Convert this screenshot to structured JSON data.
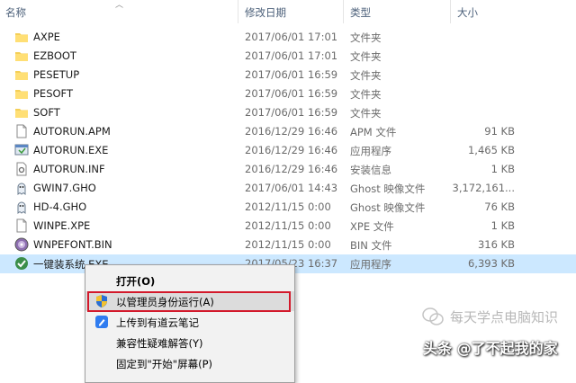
{
  "columns": {
    "name": "名称",
    "modified": "修改日期",
    "type": "类型",
    "size": "大小"
  },
  "files": [
    {
      "name": "AXPE",
      "modified": "2017/06/01 17:01",
      "type": "文件夹",
      "size": "",
      "icon": "folder-icon"
    },
    {
      "name": "EZBOOT",
      "modified": "2017/06/01 17:01",
      "type": "文件夹",
      "size": "",
      "icon": "folder-icon"
    },
    {
      "name": "PESETUP",
      "modified": "2017/06/01 16:59",
      "type": "文件夹",
      "size": "",
      "icon": "folder-icon"
    },
    {
      "name": "PESOFT",
      "modified": "2017/06/01 16:59",
      "type": "文件夹",
      "size": "",
      "icon": "folder-icon"
    },
    {
      "name": "SOFT",
      "modified": "2017/06/01 16:59",
      "type": "文件夹",
      "size": "",
      "icon": "folder-icon"
    },
    {
      "name": "AUTORUN.APM",
      "modified": "2016/12/29 16:46",
      "type": "APM 文件",
      "size": "91 KB",
      "icon": "file-icon"
    },
    {
      "name": "AUTORUN.EXE",
      "modified": "2016/12/29 16:46",
      "type": "应用程序",
      "size": "1,465 KB",
      "icon": "application-icon"
    },
    {
      "name": "AUTORUN.INF",
      "modified": "2016/12/29 16:46",
      "type": "安装信息",
      "size": "1 KB",
      "icon": "settings-file-icon"
    },
    {
      "name": "GWIN7.GHO",
      "modified": "2017/06/01 14:43",
      "type": "Ghost 映像文件",
      "size": "3,172,161...",
      "icon": "ghost-icon"
    },
    {
      "name": "HD-4.GHO",
      "modified": "2012/11/15 0:00",
      "type": "Ghost 映像文件",
      "size": "76 KB",
      "icon": "ghost-icon"
    },
    {
      "name": "WINPE.XPE",
      "modified": "2012/11/15 0:00",
      "type": "XPE 文件",
      "size": "1 KB",
      "icon": "file-icon"
    },
    {
      "name": "WNPEFONT.BIN",
      "modified": "2012/11/15 0:00",
      "type": "BIN 文件",
      "size": "316 KB",
      "icon": "disc-icon"
    },
    {
      "name": "一键装系统.EXE",
      "modified": "2017/05/23 16:37",
      "type": "应用程序",
      "size": "6,393 KB",
      "icon": "installer-icon",
      "selected": true
    }
  ],
  "context_menu": {
    "items": [
      {
        "label": "打开(O)",
        "bold": true,
        "icon": ""
      },
      {
        "label": "以管理员身份运行(A)",
        "bold": false,
        "icon": "uac-shield-icon",
        "highlighted": true
      },
      {
        "label": "上传到有道云笔记",
        "bold": false,
        "icon": "youdao-note-icon"
      },
      {
        "label": "兼容性疑难解答(Y)",
        "bold": false,
        "icon": ""
      },
      {
        "label": "固定到\"开始\"屏幕(P)",
        "bold": false,
        "icon": ""
      }
    ]
  },
  "watermark": {
    "line1": "每天学点电脑知识",
    "line2": "头条 @了不起我的家"
  }
}
